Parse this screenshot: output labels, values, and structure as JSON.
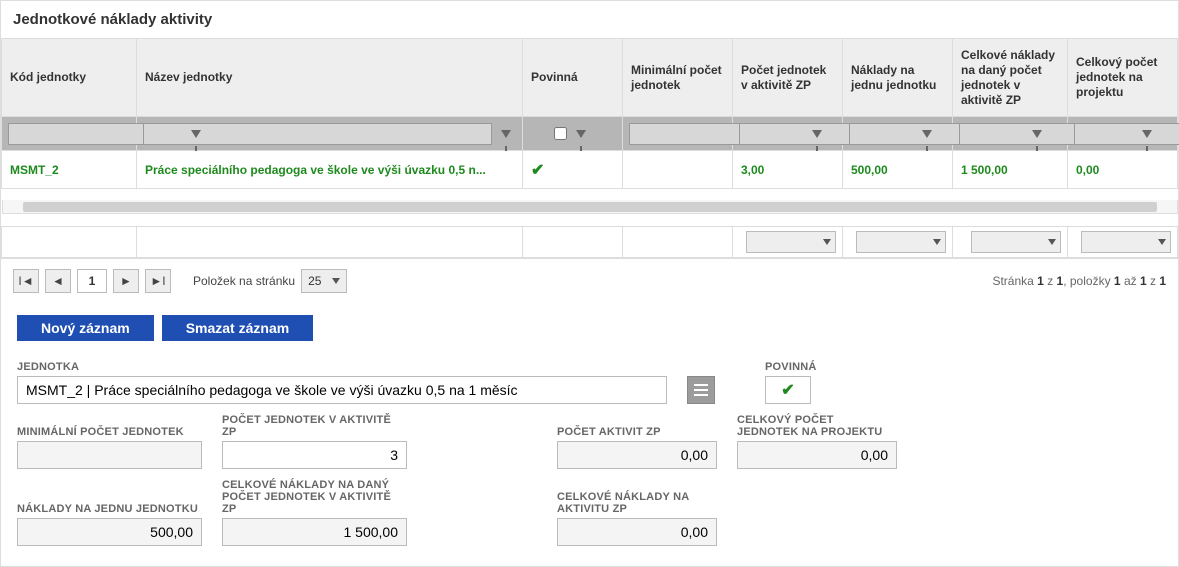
{
  "title": "Jednotkové náklady aktivity",
  "columns": {
    "kod": "Kód jednotky",
    "nazev": "Název jednotky",
    "povinna": "Povinná",
    "min": "Minimální počet jednotek",
    "pocet_zp": "Počet jednotek v aktivitě ZP",
    "naklady_jednotka": "Náklady na jednu jednotku",
    "celkove_zp": "Celkové náklady na daný počet jednotek v aktivitě ZP",
    "pocet_proj": "Celkový počet jednotek na projektu"
  },
  "row": {
    "kod": "MSMT_2",
    "nazev": "Práce speciálního pedagoga ve škole ve výši úvazku 0,5 n...",
    "povinna_check": "✔",
    "min": "",
    "pocet_zp": "3,00",
    "naklady_jednotka": "500,00",
    "celkove_zp": "1 500,00",
    "pocet_proj": "0,00"
  },
  "pager": {
    "page": "1",
    "per_label": "Položek na stránku",
    "per_value": "25",
    "info_prefix": "Stránka ",
    "info_b1": "1",
    "info_mid1": " z ",
    "info_b2": "1",
    "info_mid2": ", položky ",
    "info_b3": "1",
    "info_mid3": " až ",
    "info_b4": "1",
    "info_mid4": " z ",
    "info_b5": "1"
  },
  "buttons": {
    "novy": "Nový záznam",
    "smazat": "Smazat záznam"
  },
  "form": {
    "jednotka_label": "JEDNOTKA",
    "jednotka_value": "MSMT_2 | Práce speciálního pedagoga ve škole ve výši úvazku 0,5 na 1 měsíc",
    "povinna_label": "POVINNÁ",
    "min_label": "MINIMÁLNÍ POČET JEDNOTEK",
    "min_value": "",
    "pocet_zp_label": "POČET JEDNOTEK V AKTIVITĚ ZP",
    "pocet_zp_value": "3",
    "pocet_aktivit_label": "POČET AKTIVIT ZP",
    "pocet_aktivit_value": "0,00",
    "pocet_proj_label": "CELKOVÝ POČET JEDNOTEK NA PROJEKTU",
    "pocet_proj_value": "0,00",
    "naklady_label": "NÁKLADY NA JEDNU JEDNOTKU",
    "naklady_value": "500,00",
    "celk_zp_label1": "CELKOVÉ NÁKLADY NA DANÝ",
    "celk_zp_label2": "POČET JEDNOTEK V AKTIVITĚ ZP",
    "celk_zp_value": "1 500,00",
    "celk_akt_label": "CELKOVÉ NÁKLADY NA AKTIVITU ZP",
    "celk_akt_value": "0,00"
  }
}
